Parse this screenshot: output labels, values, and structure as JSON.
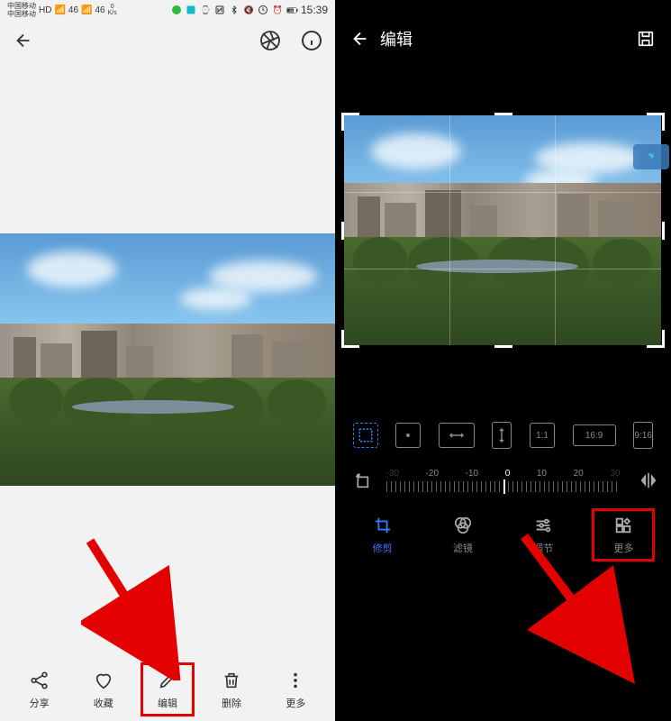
{
  "statusbar": {
    "carrier": "中国移动",
    "net1": "HD",
    "net2": "46",
    "speed_up": "0",
    "speed_unit": "K/s",
    "battery": "68",
    "time": "15:39"
  },
  "left": {
    "bottom": {
      "share": "分享",
      "favorite": "收藏",
      "edit": "编辑",
      "delete": "删除",
      "more": "更多"
    }
  },
  "right": {
    "title": "编辑",
    "ratios": {
      "free": "",
      "orig": "",
      "wide": "",
      "sq": "1:1",
      "r169": "16:9",
      "r916": "9:16"
    },
    "ruler": {
      "n30": "-30",
      "n20": "-20",
      "n10": "-10",
      "zero": "0",
      "p10": "10",
      "p20": "20",
      "p30": "30"
    },
    "tabs": {
      "crop": "修剪",
      "filter": "滤镜",
      "adjust": "调节",
      "more": "更多"
    }
  }
}
